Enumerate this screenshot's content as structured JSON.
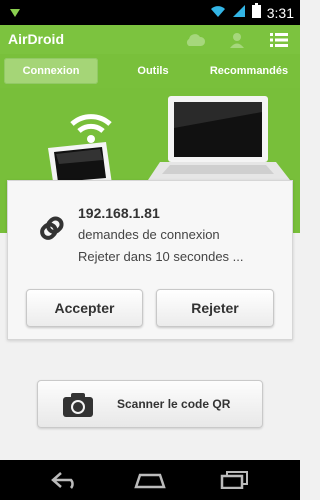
{
  "status_bar": {
    "time": "3:31",
    "icons": [
      "notification-icon",
      "wifi-icon",
      "signal-icon",
      "battery-icon"
    ]
  },
  "app": {
    "title": "AirDroid",
    "actions": [
      "cloud-icon",
      "account-icon",
      "menu-icon"
    ]
  },
  "tabs": [
    {
      "label": "Connexion",
      "active": true
    },
    {
      "label": "Outils",
      "active": false
    },
    {
      "label": "Recommandés",
      "active": false
    }
  ],
  "dialog": {
    "ip": "192.168.1.81",
    "request": "demandes de connexion",
    "countdown": "Rejeter dans 10 secondes ...",
    "accept_label": "Accepter",
    "reject_label": "Rejeter"
  },
  "qr": {
    "label": "Scanner le code QR"
  },
  "nav": [
    "back-icon",
    "home-icon",
    "recent-apps-icon"
  ],
  "colors": {
    "brand_green": "#7cc33f",
    "status_black": "#000000"
  }
}
